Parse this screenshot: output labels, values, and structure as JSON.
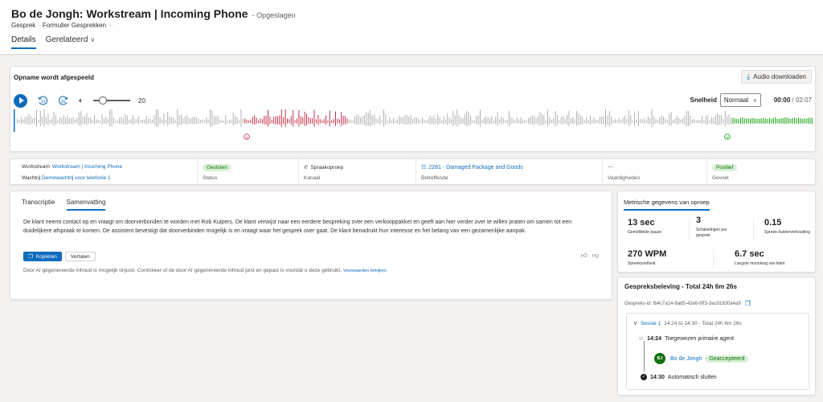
{
  "header": {
    "title": "Bo de Jongh: Workstream  | Incoming Phone",
    "status": "- Opgeslagen",
    "crumb_entity": "Gesprek",
    "crumb_sep": "·",
    "crumb_form": "Formulier Gesprekken",
    "tabs": [
      {
        "label": "Details"
      },
      {
        "label": "Gerelateerd"
      }
    ]
  },
  "player": {
    "title": "Opname wordt afgespeeld",
    "download_label": "Audio downloaden",
    "skip_back": "10",
    "skip_forward": "30",
    "volume": 20,
    "speed_label": "Snelheid",
    "speed_value": "Normaal",
    "current_time": "00:00",
    "duration": "/ 02:07",
    "progress": 0,
    "negative_segment": [
      0.285,
      0.415
    ],
    "positive_segment": [
      0.895,
      1.0
    ],
    "colors": {
      "neutral": "#b3b0ad",
      "negative": "#c4314b",
      "positive": "#13a10e",
      "accent": "#0f6cbd"
    }
  },
  "info": {
    "workstream_label": "Workstream",
    "workstream_value": "Workstream | Incoming Phone",
    "queue_label": "Wachtrij",
    "queue_value": "Demowachtrij voor telefonie 1",
    "status_value": "Gesloten",
    "status_label": "Status",
    "channel_value": "Spraakoproep",
    "channel_label": "Kanaal",
    "regarding_value": "2281 - Damaged Package and Goods",
    "regarding_label": "Betreffende",
    "skills_value": "---",
    "skills_label": "Vaardigheden",
    "sentiment_value": "Positief",
    "sentiment_label": "Gevoel"
  },
  "summary": {
    "tab_transcript": "Transcriptie",
    "tab_summary": "Samenvatting",
    "text": "De klant neemt contact op en vraagt om doorverbonden te worden met Rob Kuipers. De klant verwijst naar een eerdere bespreking over een verkooppakket en geeft aan hier verder over te willen praten om samen tot een duidelijkere afspraak te komen. De assistent bevestigt dat doorverbinden mogelijk is en vraagt waar het gesprek over gaat. De klant benadrukt hun interesse en het belang van een gezamenlijke aanpak.",
    "copy_label": "Kopiëren",
    "translate_label": "Vertalen",
    "disclaimer": "Door AI gegenereerde inhoud is mogelijk onjuist. Controleer of de door AI gegenereerde inhoud juist en gepast is voordat u deze gebruikt.",
    "terms_link": "Voorwaarden bekijken"
  },
  "metrics": {
    "tab": "Metrische gegevens van oproep",
    "avg_pause_value": "13 sec",
    "avg_pause_label": "Gemiddelde pauze",
    "switches_value": "3",
    "switches_label_1": "Schakelingen per",
    "switches_label_2": "gesprek",
    "talk_ratio_value": "0.15",
    "talk_ratio_label": "Spreek-/luisterverhouding",
    "speed_value": "270 WPM",
    "speed_label": "Spreeksnelheid",
    "monologue_value": "6.7 sec",
    "monologue_label": "Langste monoloog van klant"
  },
  "experience": {
    "title": "Gespreksbeleving - Total 24h 6m 26s",
    "id_text": "Gespreks-id: fb4c7a14-9ad5-42e6-9ff3-3ac91930a4a9",
    "session_name": "Sessie 1",
    "session_detail": "14:24 to 14:30 - Total 24h 6m 26s",
    "event1_time": "14:24",
    "event1_text": "Toegewezen primaire agent",
    "agent_initials": "BJ",
    "agent_name": "Bo de Jongh",
    "agent_status": "Geaccepteerd",
    "event2_time": "14:30",
    "event2_text": "Automatisch sluiten"
  }
}
